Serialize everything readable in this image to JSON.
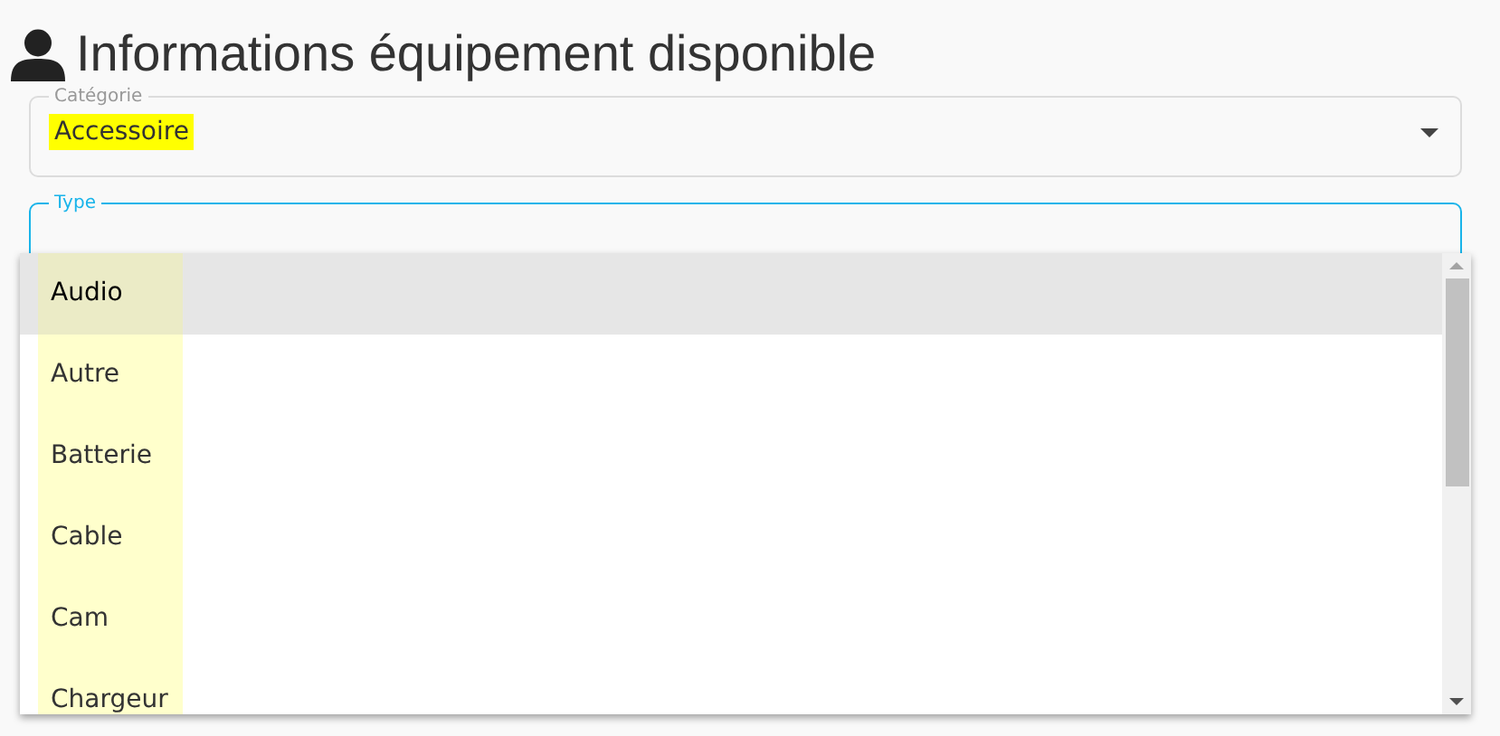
{
  "title": "Informations équipement disponible",
  "fields": [
    {
      "legend": "Catégorie",
      "value": "Accessoire",
      "highlighted": true,
      "focused": false
    },
    {
      "legend": "Type",
      "focused": true
    }
  ],
  "dropdown": {
    "options": [
      {
        "label": "Audio",
        "selected": true,
        "highlighted": true
      },
      {
        "label": "Autre",
        "selected": false,
        "highlighted": true
      },
      {
        "label": "Batterie",
        "selected": false,
        "highlighted": true
      },
      {
        "label": "Cable",
        "selected": false,
        "highlighted": true
      },
      {
        "label": "Cam",
        "selected": false,
        "highlighted": true
      },
      {
        "label": "Chargeur",
        "selected": false,
        "highlighted": true
      }
    ]
  }
}
